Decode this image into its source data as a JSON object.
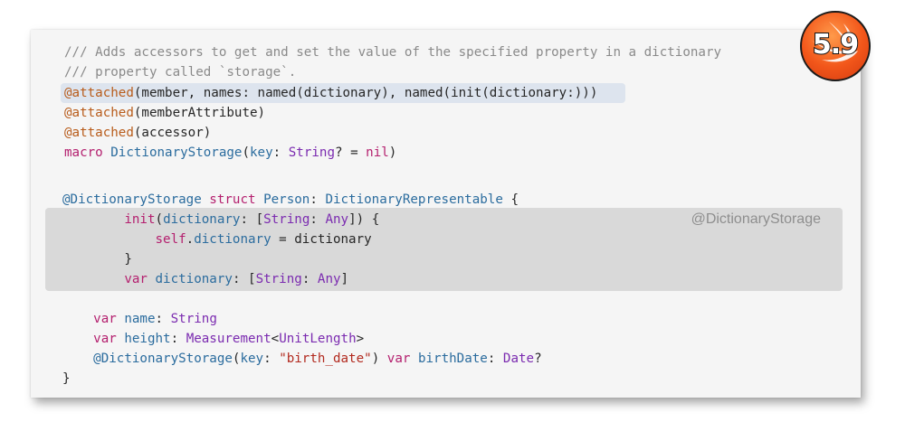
{
  "badge": {
    "version": "5.9"
  },
  "expansion_label": "@DictionaryStorage",
  "code_lines": [
    [
      {
        "t": "/// Adds accessors to get and set the value of the specified property in a dictionary",
        "c": "c"
      }
    ],
    [
      {
        "t": "/// property called `storage`.",
        "c": "c"
      }
    ],
    [
      {
        "t": "@attached",
        "c": "a"
      },
      {
        "t": "(member, names: named(dictionary), named(init(dictionary:)))",
        "c": "p"
      }
    ],
    [
      {
        "t": "@attached",
        "c": "a"
      },
      {
        "t": "(memberAttribute)",
        "c": "p"
      }
    ],
    [
      {
        "t": "@attached",
        "c": "a"
      },
      {
        "t": "(accessor)",
        "c": "p"
      }
    ],
    [
      {
        "t": "macro ",
        "c": "k"
      },
      {
        "t": "DictionaryStorage",
        "c": "n"
      },
      {
        "t": "(",
        "c": "p"
      },
      {
        "t": "key",
        "c": "n"
      },
      {
        "t": ": ",
        "c": "p"
      },
      {
        "t": "String",
        "c": "t"
      },
      {
        "t": "? = ",
        "c": "p"
      },
      {
        "t": "nil",
        "c": "k"
      },
      {
        "t": ")",
        "c": "p"
      }
    ],
    [
      {
        "t": "",
        "c": "p"
      }
    ],
    [
      {
        "t": "@DictionaryStorage ",
        "c": "n"
      },
      {
        "t": "struct ",
        "c": "k"
      },
      {
        "t": "Person",
        "c": "n"
      },
      {
        "t": ": ",
        "c": "p"
      },
      {
        "t": "DictionaryRepresentable",
        "c": "n"
      },
      {
        "t": " {",
        "c": "p"
      }
    ],
    [
      {
        "t": "        ",
        "c": "p"
      },
      {
        "t": "init",
        "c": "k"
      },
      {
        "t": "(",
        "c": "p"
      },
      {
        "t": "dictionary",
        "c": "n"
      },
      {
        "t": ": [",
        "c": "p"
      },
      {
        "t": "String",
        "c": "t"
      },
      {
        "t": ": ",
        "c": "p"
      },
      {
        "t": "Any",
        "c": "t"
      },
      {
        "t": "]) {",
        "c": "p"
      }
    ],
    [
      {
        "t": "            ",
        "c": "p"
      },
      {
        "t": "self",
        "c": "k"
      },
      {
        "t": ".",
        "c": "p"
      },
      {
        "t": "dictionary",
        "c": "n"
      },
      {
        "t": " = dictionary",
        "c": "p"
      }
    ],
    [
      {
        "t": "        }",
        "c": "p"
      }
    ],
    [
      {
        "t": "        ",
        "c": "p"
      },
      {
        "t": "var ",
        "c": "k"
      },
      {
        "t": "dictionary",
        "c": "n"
      },
      {
        "t": ": [",
        "c": "p"
      },
      {
        "t": "String",
        "c": "t"
      },
      {
        "t": ": ",
        "c": "p"
      },
      {
        "t": "Any",
        "c": "t"
      },
      {
        "t": "]",
        "c": "p"
      }
    ],
    [
      {
        "t": "",
        "c": "p"
      }
    ],
    [
      {
        "t": "    ",
        "c": "p"
      },
      {
        "t": "var ",
        "c": "k"
      },
      {
        "t": "name",
        "c": "n"
      },
      {
        "t": ": ",
        "c": "p"
      },
      {
        "t": "String",
        "c": "t"
      }
    ],
    [
      {
        "t": "    ",
        "c": "p"
      },
      {
        "t": "var ",
        "c": "k"
      },
      {
        "t": "height",
        "c": "n"
      },
      {
        "t": ": ",
        "c": "p"
      },
      {
        "t": "Measurement",
        "c": "t"
      },
      {
        "t": "<",
        "c": "p"
      },
      {
        "t": "UnitLength",
        "c": "t"
      },
      {
        "t": ">",
        "c": "p"
      }
    ],
    [
      {
        "t": "    ",
        "c": "p"
      },
      {
        "t": "@DictionaryStorage",
        "c": "n"
      },
      {
        "t": "(",
        "c": "p"
      },
      {
        "t": "key",
        "c": "n"
      },
      {
        "t": ": ",
        "c": "p"
      },
      {
        "t": "\"birth_date\"",
        "c": "s"
      },
      {
        "t": ") ",
        "c": "p"
      },
      {
        "t": "var ",
        "c": "k"
      },
      {
        "t": "birthDate",
        "c": "n"
      },
      {
        "t": ": ",
        "c": "p"
      },
      {
        "t": "Date",
        "c": "t"
      },
      {
        "t": "?",
        "c": "p"
      }
    ],
    [
      {
        "t": "}",
        "c": "p"
      }
    ]
  ]
}
